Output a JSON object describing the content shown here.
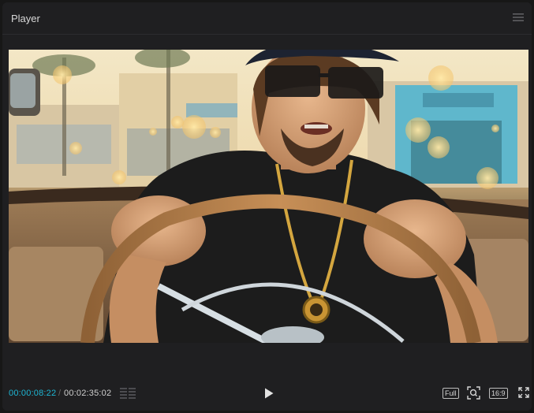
{
  "panel": {
    "title": "Player"
  },
  "playback": {
    "current_time": "00:00:08:22",
    "separator": "/",
    "total_time": "00:02:35:02"
  },
  "controls": {
    "full_label": "Full",
    "aspect_ratio_label": "16:9"
  },
  "icons": {
    "menu": "hamburger-menu-icon",
    "grid": "grid-view-icon",
    "play": "play-icon",
    "zoom": "zoom-fit-icon",
    "fullscreen": "expand-fullscreen-icon"
  },
  "colors": {
    "accent_timecode": "#1fb6d4",
    "panel_bg": "#1f1f21"
  }
}
